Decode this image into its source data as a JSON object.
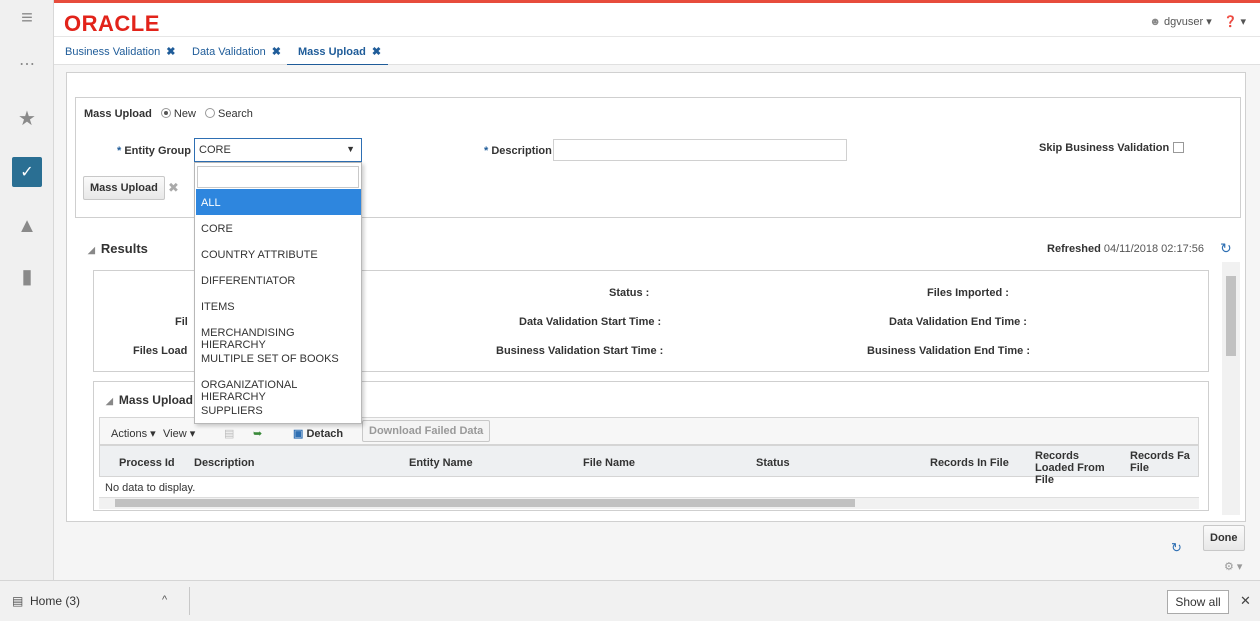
{
  "brand": "ORACLE",
  "user": {
    "name": "dgvuser ▾",
    "help": "❓ ▾"
  },
  "tabs": [
    {
      "label": "Business Validation",
      "close": "✖"
    },
    {
      "label": "Data Validation",
      "close": "✖"
    },
    {
      "label": "Mass Upload",
      "close": "✖"
    }
  ],
  "form": {
    "mass_upload_label": "Mass Upload",
    "radio_new": "New",
    "radio_search": "Search",
    "entity_group_label": "Entity Group",
    "entity_group_value": "CORE",
    "description_label": "Description",
    "skip_label": "Skip Business Validation",
    "mass_upload_button": "Mass Upload",
    "required_mark": "*"
  },
  "dropdown_options": [
    "ALL",
    "CORE",
    "COUNTRY ATTRIBUTE",
    "DIFFERENTIATOR",
    "ITEMS",
    "MERCHANDISING HIERARCHY",
    "MULTIPLE SET OF BOOKS",
    "ORGANIZATIONAL HIERARCHY",
    "SUPPLIERS"
  ],
  "results": {
    "title": "Results",
    "refreshed_label": "Refreshed",
    "refreshed_value": "04/11/2018 02:17:56",
    "fields": {
      "status": "Status :",
      "files_imported": "Files Imported :",
      "file_partial": "Fil",
      "data_val_start": "Data Validation Start Time :",
      "data_val_end": "Data Validation End Time :",
      "files_load_partial": "Files Load",
      "biz_val_start": "Business Validation Start Time :",
      "biz_val_end": "Business Validation End Time :"
    }
  },
  "mass_upload_section": {
    "title": "Mass Upload",
    "toolbar": {
      "actions": "Actions ▾",
      "view": "View ▾",
      "detach": "Detach",
      "download": "Download Failed Data"
    },
    "columns": [
      "Process Id",
      "Description",
      "Entity Name",
      "File Name",
      "Status",
      "Records In File",
      "Records Loaded From File",
      "Records Fa File"
    ],
    "empty": "No data to display."
  },
  "footer": {
    "done": "Done"
  },
  "downloads": {
    "home": "Home (3)",
    "caret": "^",
    "show_all": "Show all",
    "close": "✕"
  }
}
